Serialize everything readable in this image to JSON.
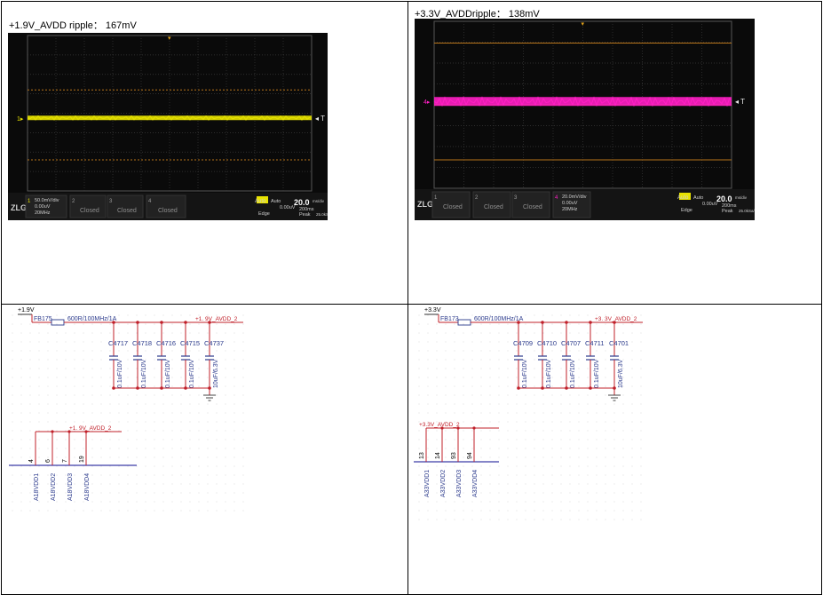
{
  "panels": [
    {
      "title": "+1.9V_AVDD ripple： 167mV",
      "scope": {
        "trace_color": "#e8e300",
        "channel_marker": "1",
        "scale_line1": "50.0mV/div",
        "scale_line2": "0.00uV",
        "scale_line3": "20MHz",
        "closed_labels": [
          "Closed",
          "Closed",
          "Closed"
        ],
        "mode": "Auto",
        "timebase": "20.0",
        "timebase_unit": "ms/div",
        "sample": "200ms",
        "peak": "Peak",
        "rate": "25.0kSa/s",
        "edge": "Edge",
        "trig_level": "0.00uV",
        "t_marker": "T"
      }
    },
    {
      "title": "+3.3V_AVDDripple： 138mV",
      "scope": {
        "trace_color": "#ff1fc4",
        "channel_marker": "4",
        "scale_line1": "20.0mV/div",
        "scale_line2": "0.00uV",
        "scale_line3": "20MHz",
        "closed_labels": [
          "Closed",
          "Closed",
          "Closed"
        ],
        "mode": "Auto",
        "timebase": "20.0",
        "timebase_unit": "ms/div",
        "sample": "200ms",
        "peak": "Peak",
        "rate": "25.0kSa/s",
        "edge": "Edge",
        "trig_level": "0.00uV",
        "t_marker": "T"
      }
    }
  ],
  "schematics": [
    {
      "supply": "+1.9V",
      "bead": "FB175",
      "bead_value": "600R/100MHz/1A",
      "net": "+1. 9V_AVDD_2",
      "capacitors": [
        {
          "ref": "C4717",
          "value": "0.1uF/10V"
        },
        {
          "ref": "C4718",
          "value": "0.1uF/10V"
        },
        {
          "ref": "C4716",
          "value": "0.1uF/10V"
        },
        {
          "ref": "C4715",
          "value": "0.1uF/10V"
        },
        {
          "ref": "C4737",
          "value": "10uF/6.3V"
        }
      ],
      "pin_net": "+1. 9V_AVDD_2",
      "pins": [
        {
          "num": "4",
          "name": "A18VDD1"
        },
        {
          "num": "6",
          "name": "A18VDD2"
        },
        {
          "num": "7",
          "name": "A18VDD3"
        },
        {
          "num": "19",
          "name": "A18VDD4"
        }
      ]
    },
    {
      "supply": "+3.3V",
      "bead": "FB173",
      "bead_value": "600R/100MHz/1A",
      "net": "+3. 3V_AVDD_2",
      "capacitors": [
        {
          "ref": "C4709",
          "value": "0.1uF/10V"
        },
        {
          "ref": "C4710",
          "value": "0.1uF/10V"
        },
        {
          "ref": "C4707",
          "value": "0.1uF/10V"
        },
        {
          "ref": "C4711",
          "value": "0.1uF/10V"
        },
        {
          "ref": "C4701",
          "value": "10uF/6.3V"
        }
      ],
      "pin_net": "+3.3V_AVDD_2",
      "pins": [
        {
          "num": "13",
          "name": "A33VDD1"
        },
        {
          "num": "14",
          "name": "A33VDD2"
        },
        {
          "num": "93",
          "name": "A33VDD3"
        },
        {
          "num": "94",
          "name": "A33VDD4"
        }
      ]
    }
  ],
  "colors": {
    "wire": "#c0202a",
    "pin_line": "#3c3ca8",
    "pin_text": "#2b3a8c",
    "component": "#2b3a8c",
    "grid_dot": "#cfcfcf",
    "scope_grid": "#3a3a3a",
    "scope_bound": "#b8741a"
  }
}
